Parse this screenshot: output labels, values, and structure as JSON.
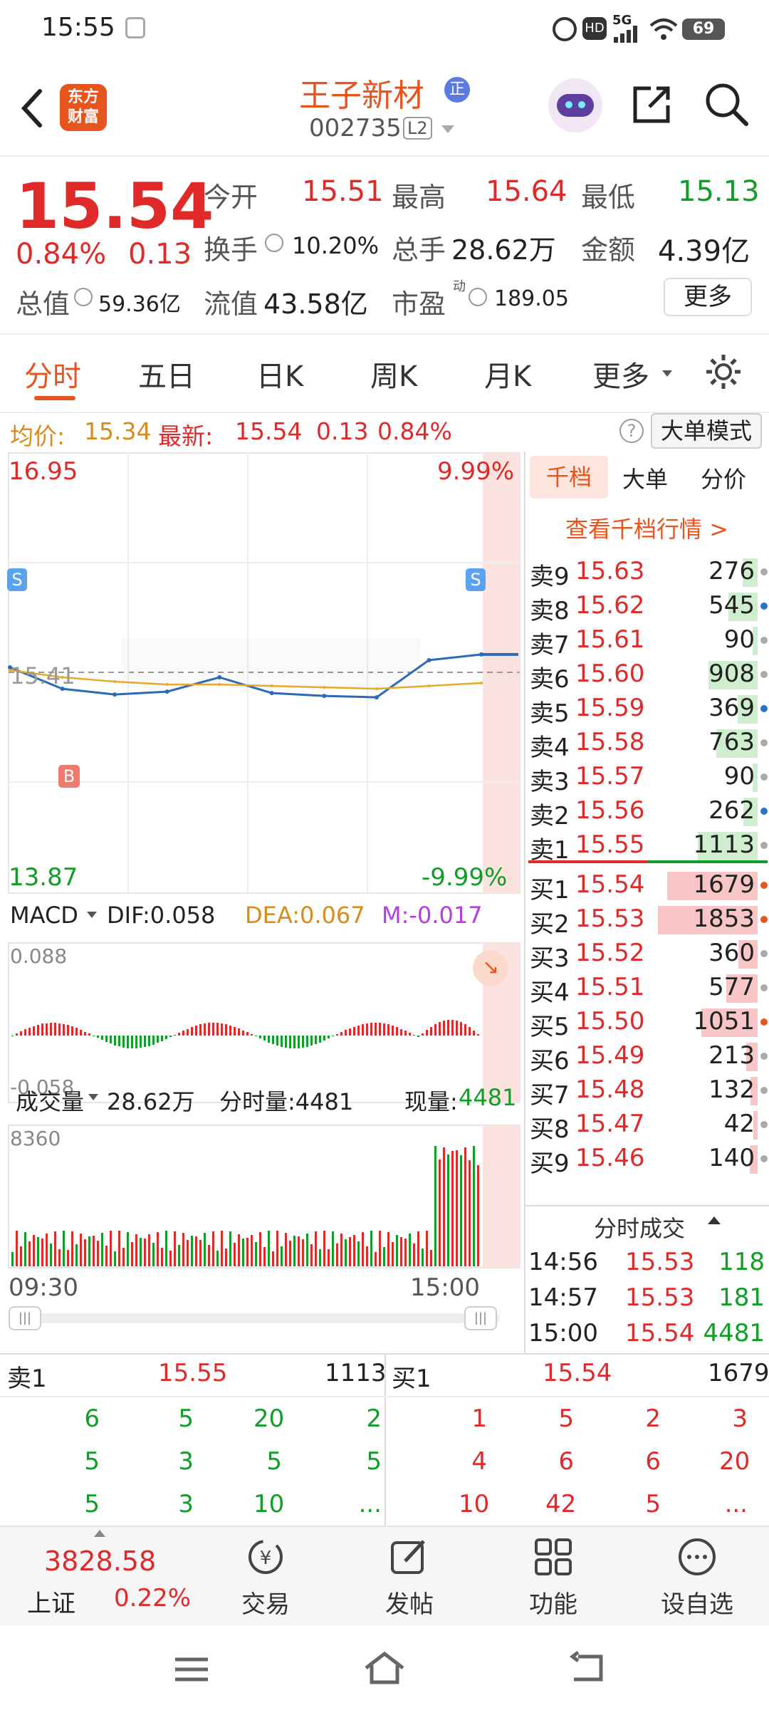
{
  "status": {
    "time": "15:55",
    "battery": "69",
    "network": "5G"
  },
  "header": {
    "logo_line1": "东方",
    "logo_line2": "财富",
    "stock_name": "王子新材",
    "code": "002735",
    "level": "L2",
    "badge": "正"
  },
  "quote": {
    "price": "15.54",
    "pct": "0.84%",
    "chg": "0.13",
    "open_label": "今开",
    "open": "15.51",
    "high_label": "最高",
    "high": "15.64",
    "low_label": "最低",
    "low": "15.13",
    "turnover_label": "换手",
    "turnover": "10.20%",
    "volume_label": "总手",
    "volume": "28.62万",
    "amount_label": "金额",
    "amount": "4.39亿",
    "mktcap_label": "总值",
    "mktcap": "59.36亿",
    "float_label": "流值",
    "float": "43.58亿",
    "pe_label": "市盈",
    "pe_sup": "动",
    "pe": "189.05",
    "more": "更多"
  },
  "tabs": [
    "分时",
    "五日",
    "日K",
    "周K",
    "月K",
    "更多"
  ],
  "infoline": {
    "avg_label": "均价:",
    "avg": "15.34",
    "latest_label": "最新:",
    "latest": "15.54",
    "chg": "0.13",
    "pct": "0.84%",
    "mode_btn": "大单模式"
  },
  "chart": {
    "y_top": "16.95",
    "y_bottom": "13.87",
    "pct_top": "9.99%",
    "pct_bottom": "-9.99%",
    "ref": "15.41",
    "macd_label": "MACD",
    "dif": "DIF:0.058",
    "dea": "DEA:0.067",
    "m": "M:-0.017",
    "macd_top": "0.088",
    "macd_bottom": "-0.058",
    "vol_label": "成交量",
    "vol_total": "28.62万",
    "vol_cur_label": "分时量:4481",
    "now_label": "现量:",
    "now_val": "4481",
    "vol_max": "8360",
    "t_start": "09:30",
    "t_end": "15:00"
  },
  "chart_data": {
    "type": "line",
    "x": [
      "09:30",
      "10:00",
      "10:30",
      "11:00",
      "11:30",
      "13:30",
      "14:00",
      "14:30",
      "14:50",
      "15:00"
    ],
    "series": [
      {
        "values": [
          15.45,
          15.3,
          15.26,
          15.28,
          15.38,
          15.27,
          15.25,
          15.24,
          15.5,
          15.54
        ]
      },
      {
        "values": [
          15.43,
          15.38,
          15.35,
          15.33,
          15.33,
          15.32,
          15.31,
          15.3,
          15.32,
          15.34
        ]
      }
    ],
    "ylim": [
      13.87,
      16.95
    ]
  },
  "orderbook": {
    "tabs": [
      "千档",
      "大单",
      "分价"
    ],
    "link": "查看千档行情 >",
    "asks": [
      {
        "label": "卖9",
        "price": "15.63",
        "vol": "276"
      },
      {
        "label": "卖8",
        "price": "15.62",
        "vol": "545"
      },
      {
        "label": "卖7",
        "price": "15.61",
        "vol": "90"
      },
      {
        "label": "卖6",
        "price": "15.60",
        "vol": "908"
      },
      {
        "label": "卖5",
        "price": "15.59",
        "vol": "369"
      },
      {
        "label": "卖4",
        "price": "15.58",
        "vol": "763"
      },
      {
        "label": "卖3",
        "price": "15.57",
        "vol": "90"
      },
      {
        "label": "卖2",
        "price": "15.56",
        "vol": "262"
      },
      {
        "label": "卖1",
        "price": "15.55",
        "vol": "1113"
      }
    ],
    "bids": [
      {
        "label": "买1",
        "price": "15.54",
        "vol": "1679"
      },
      {
        "label": "买2",
        "price": "15.53",
        "vol": "1853"
      },
      {
        "label": "买3",
        "price": "15.52",
        "vol": "360"
      },
      {
        "label": "买4",
        "price": "15.51",
        "vol": "577"
      },
      {
        "label": "买5",
        "price": "15.50",
        "vol": "1051"
      },
      {
        "label": "买6",
        "price": "15.49",
        "vol": "213"
      },
      {
        "label": "买7",
        "price": "15.48",
        "vol": "132"
      },
      {
        "label": "买8",
        "price": "15.47",
        "vol": "42"
      },
      {
        "label": "买9",
        "price": "15.46",
        "vol": "140"
      }
    ],
    "trades_title": "分时成交",
    "trades": [
      {
        "t": "14:56",
        "p": "15.53",
        "v": "118"
      },
      {
        "t": "14:57",
        "p": "15.53",
        "v": "181"
      },
      {
        "t": "15:00",
        "p": "15.54",
        "v": "4481"
      }
    ]
  },
  "ticks": {
    "sell_label": "卖1",
    "sell_price": "15.55",
    "sell_vol": "1113",
    "buy_label": "买1",
    "buy_price": "15.54",
    "buy_vol": "1679",
    "sell_rows": [
      [
        "6",
        "5",
        "20",
        "2"
      ],
      [
        "5",
        "3",
        "5",
        "5"
      ],
      [
        "5",
        "3",
        "10",
        "..."
      ]
    ],
    "buy_rows": [
      [
        "1",
        "5",
        "2",
        "3"
      ],
      [
        "4",
        "6",
        "6",
        "20"
      ],
      [
        "10",
        "42",
        "5",
        "..."
      ]
    ]
  },
  "bottombar": {
    "index_val": "3828.58",
    "index_name": "上证",
    "index_pct": "0.22%",
    "trade": "交易",
    "post": "发帖",
    "func": "功能",
    "watch": "设自选"
  }
}
